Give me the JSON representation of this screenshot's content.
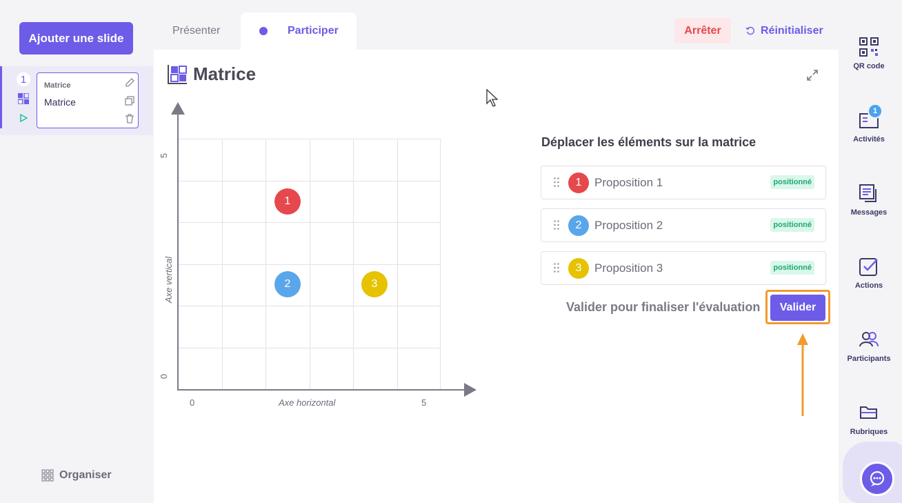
{
  "sidebar": {
    "add_slide_label": "Ajouter une slide",
    "slide": {
      "number": "1",
      "kind": "Matrice",
      "title": "Matrice"
    },
    "organise_label": "Organiser"
  },
  "tabs": {
    "present": "Présenter",
    "participate": "Participer"
  },
  "header": {
    "stop_label": "Arrêter",
    "reset_label": "Réinitialiser"
  },
  "page": {
    "title": "Matrice"
  },
  "matrix": {
    "y_label": "Axe vertical",
    "x_label": "Axe horizontal",
    "x_ticks": [
      "0",
      "5"
    ],
    "y_ticks": [
      "5",
      "0"
    ],
    "markers": [
      {
        "label": "1",
        "color": "#e5484d"
      },
      {
        "label": "2",
        "color": "#5aa6ea"
      },
      {
        "label": "3",
        "color": "#e6c200"
      }
    ]
  },
  "panel": {
    "instruction": "Déplacer les éléments sur la matrice",
    "propositions": [
      {
        "num": "1",
        "label": "Proposition 1",
        "status": "positionné",
        "color": "#e5484d"
      },
      {
        "num": "2",
        "label": "Proposition 2",
        "status": "positionné",
        "color": "#5aa6ea"
      },
      {
        "num": "3",
        "label": "Proposition 3",
        "status": "positionné",
        "color": "#e6c200"
      }
    ],
    "validate_hint": "Valider pour finaliser l'évaluation",
    "validate_label": "Valider"
  },
  "rail": {
    "qr": "QR code",
    "activities": "Activités",
    "activities_count": "1",
    "messages": "Messages",
    "actions": "Actions",
    "participants": "Participants",
    "rubriques": "Rubriques"
  },
  "colors": {
    "accent": "#6c5ce7",
    "danger": "#e5484d",
    "success": "#1fa971",
    "highlight": "#f29a2e"
  }
}
